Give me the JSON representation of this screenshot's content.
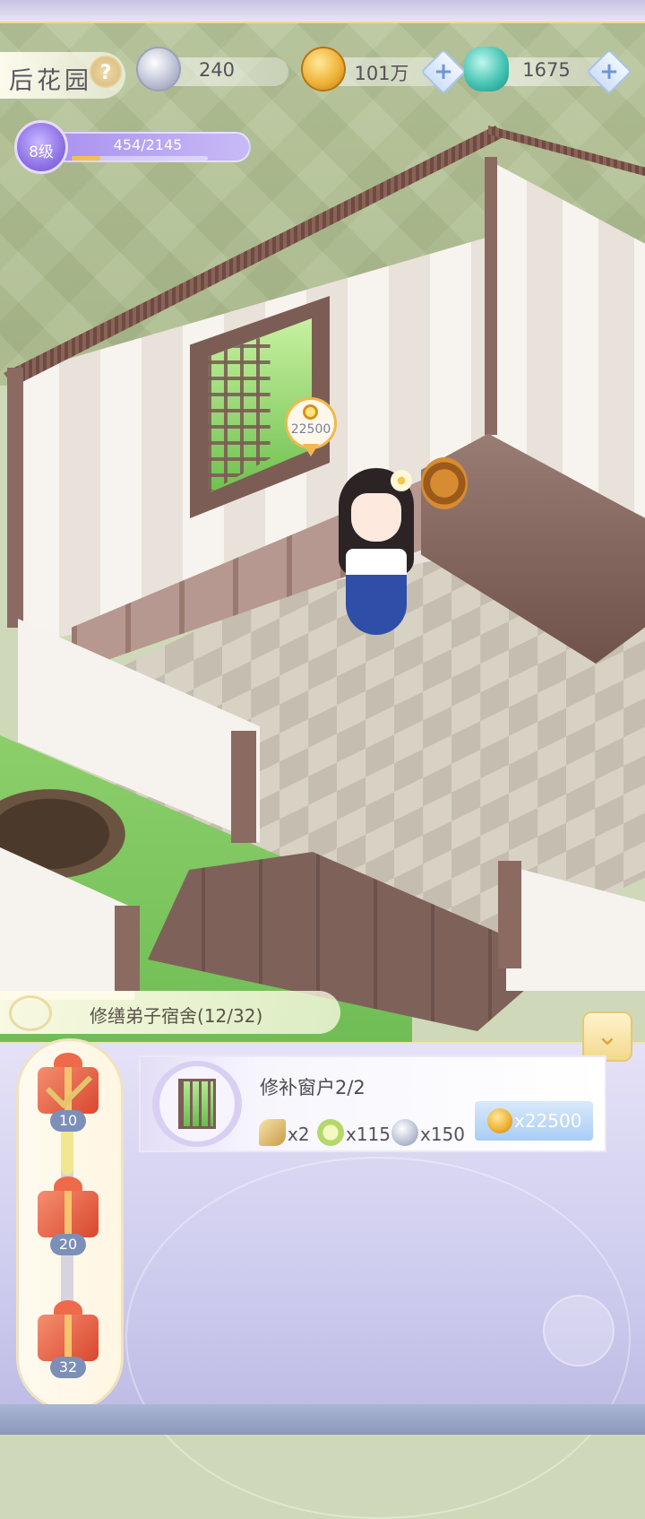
{
  "header": {
    "title": "后花园",
    "help_icon": "question-mark-icon",
    "help_label": "?"
  },
  "resources": {
    "silver": {
      "icon": "silver-coin-icon",
      "value": "240"
    },
    "gold": {
      "icon": "gold-coin-icon",
      "value": "101万",
      "plus": "+"
    },
    "jade": {
      "icon": "jade-dragon-icon",
      "value": "1675",
      "plus": "+"
    }
  },
  "level": {
    "label": "8级",
    "xp": "454/2145",
    "xp_fraction": 0.212
  },
  "scene": {
    "window_price": "22500",
    "price_icon": "gold-coin-icon"
  },
  "task": {
    "header": "修缮弟子宿舍(12/32)",
    "collapse_icon": "chevron-down-icon",
    "name": "修补窗户2/2",
    "requirements": [
      {
        "icon": "scroll-icon",
        "amount": "x2"
      },
      {
        "icon": "cabbage-icon",
        "amount": "x115"
      },
      {
        "icon": "silver-coin-icon",
        "amount": "x150"
      }
    ],
    "cost": "x22500",
    "cost_icon": "gold-coin-icon"
  },
  "milestones": [
    {
      "label": "10",
      "claimed": true
    },
    {
      "label": "20",
      "claimed": false
    },
    {
      "label": "32",
      "claimed": false
    }
  ],
  "colors": {
    "accent_gold": "#f0b43a",
    "level_purple": "#8f73e6",
    "cost_blue": "#a9cdf5"
  }
}
